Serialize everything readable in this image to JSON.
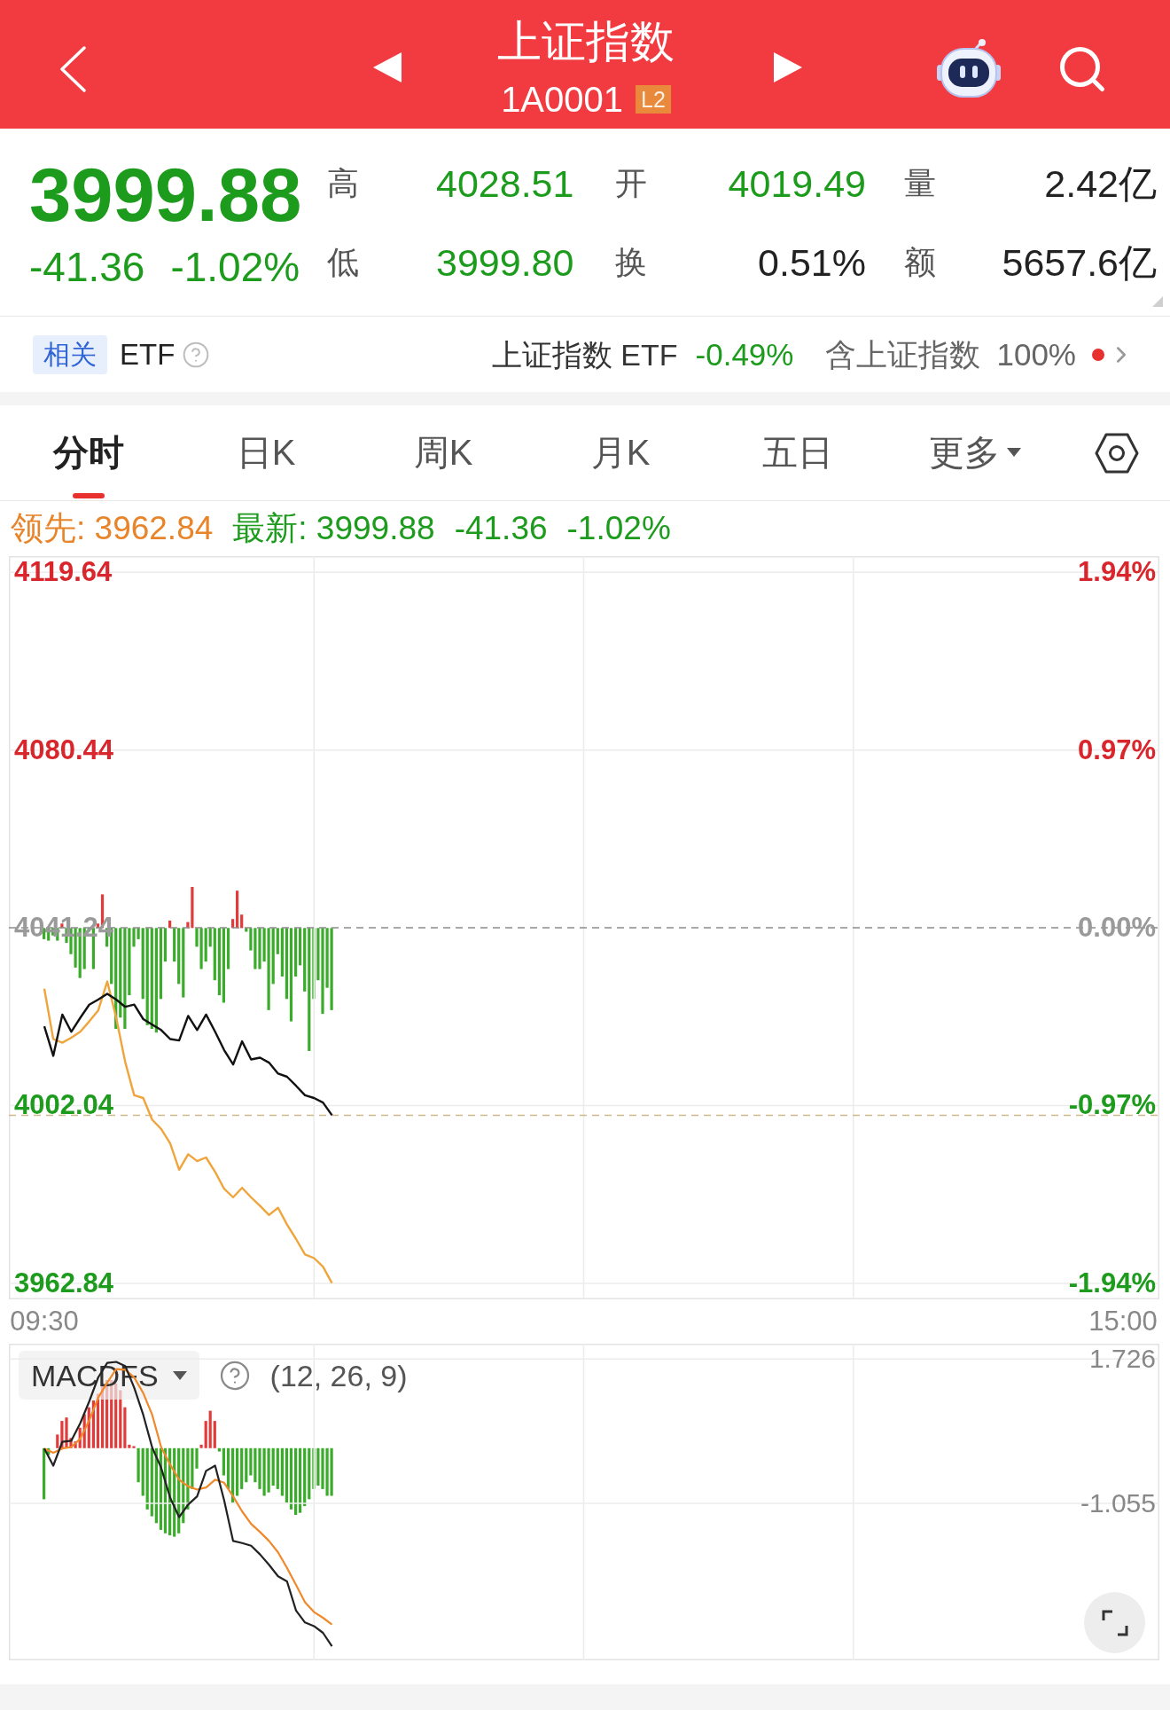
{
  "header": {
    "title": "上证指数",
    "code": "1A0001",
    "badge": "L2"
  },
  "quote": {
    "price": "3999.88",
    "change": "-41.36",
    "change_pct": "-1.02%",
    "falling": true,
    "stats": [
      {
        "label": "高",
        "value": "4028.51",
        "color": "#1c9b1c"
      },
      {
        "label": "开",
        "value": "4019.49",
        "color": "#1c9b1c"
      },
      {
        "label": "量",
        "value": "2.42亿",
        "color": "#222222"
      },
      {
        "label": "低",
        "value": "3999.80",
        "color": "#1c9b1c"
      },
      {
        "label": "换",
        "value": "0.51%",
        "color": "#222222"
      },
      {
        "label": "额",
        "value": "5657.6亿",
        "color": "#222222"
      }
    ]
  },
  "etf_row": {
    "tag": "相关",
    "label": "ETF",
    "fund": "上证指数 ETF",
    "fund_change": "-0.49%",
    "fund_falling": true,
    "holding_label": "含上证指数",
    "holding_pct": "100%"
  },
  "tabs": [
    {
      "label": "分时",
      "kind": "tab",
      "selected": true
    },
    {
      "label": "日K",
      "kind": "tab",
      "selected": false
    },
    {
      "label": "周K",
      "kind": "tab",
      "selected": false
    },
    {
      "label": "月K",
      "kind": "tab",
      "selected": false
    },
    {
      "label": "五日",
      "kind": "tab",
      "selected": false
    },
    {
      "label": "更多",
      "kind": "menu",
      "selected": false
    }
  ],
  "intraday": {
    "legend": [
      {
        "text": "领先: 3962.84",
        "kind": "lead"
      },
      {
        "text": "最新: 3999.88",
        "kind": "latest"
      },
      {
        "text": "-41.36",
        "kind": "latest"
      },
      {
        "text": "-1.02%",
        "kind": "latest"
      }
    ],
    "percent_ticks": [
      "1.94%",
      "0.97%",
      "0.00%",
      "-0.97%",
      "-1.94%"
    ],
    "chart_data": {
      "type": "line",
      "grid": true,
      "categories": [
        "09:30",
        null,
        null,
        null,
        null,
        null,
        null,
        null,
        null,
        null,
        null,
        null,
        null,
        null,
        null,
        null,
        null,
        null,
        null,
        null,
        null,
        null,
        null,
        null,
        null,
        null,
        null,
        null,
        null,
        null,
        null,
        null,
        null,
        null,
        null,
        null,
        null,
        null,
        null,
        null,
        null,
        null,
        null,
        null,
        null,
        null,
        null,
        null,
        null,
        null,
        null,
        null,
        null,
        null,
        null,
        null,
        null,
        null,
        null,
        null,
        null,
        null,
        null,
        null,
        null,
        null,
        null,
        null,
        null,
        null,
        null,
        null,
        null,
        null,
        null,
        null,
        null,
        null,
        null,
        null,
        null,
        null,
        null,
        null,
        null,
        null,
        null,
        null,
        null,
        null,
        null,
        null,
        null,
        null,
        null,
        null,
        null,
        null,
        null,
        null,
        null,
        null,
        null,
        null,
        null,
        null,
        null,
        null,
        null,
        null,
        null,
        null,
        null,
        null,
        null,
        null,
        null,
        null,
        null,
        null,
        "15:00"
      ],
      "ylim": [
        3959.3,
        4123.2
      ],
      "yticks": [
        {
          "value": 4119.64,
          "label": "4119.64"
        },
        {
          "value": 4080.44,
          "label": "4080.44"
        },
        {
          "value": 4041.24,
          "label": "4041.24"
        },
        {
          "value": 4002.04,
          "label": "4002.04"
        },
        {
          "value": 3962.84,
          "label": "3962.84"
        }
      ],
      "series": [
        {
          "color": "#111111",
          "values": [
            4019.5,
            4013.0,
            4022.1,
            4018.3,
            4021.4,
            4024.3,
            4025.4,
            4026.7,
            4025.4,
            4023.8,
            4024.3,
            4021.1,
            4019.9,
            4018.7,
            4016.7,
            4016.4,
            4021.8,
            4018.7,
            4022.1,
            4018.3,
            4014.3,
            4011.1,
            4016.2,
            4012.2,
            4012.6,
            4011.5,
            4009.1,
            4008.4,
            4006.4,
            4004.3,
            4003.7,
            4002.7,
            3999.9,
            null,
            null,
            null,
            null,
            null,
            null,
            null,
            null,
            null,
            null,
            null,
            null,
            null,
            null,
            null,
            null,
            null,
            null,
            null,
            null,
            null,
            null,
            null,
            null,
            null,
            null,
            null,
            null,
            null,
            null,
            null,
            null,
            null,
            null,
            null,
            null,
            null,
            null,
            null,
            null,
            null,
            null,
            null,
            null,
            null,
            null,
            null,
            null,
            null,
            null,
            null,
            null,
            null,
            null,
            null,
            null,
            null,
            null,
            null,
            null,
            null,
            null,
            null,
            null,
            null,
            null,
            null,
            null,
            null,
            null,
            null,
            null,
            null,
            null,
            null,
            null,
            null,
            null,
            null,
            null,
            null,
            null,
            null,
            null,
            null,
            null,
            null,
            null
          ]
        },
        {
          "color": "#f0a53c",
          "values": [
            4027.8,
            4016.7,
            4015.9,
            4017.0,
            4018.3,
            4020.6,
            4023.0,
            4029.4,
            4021.4,
            4011.6,
            4004.3,
            4003.7,
            3998.9,
            3996.9,
            3993.7,
            3987.9,
            3991.3,
            3989.8,
            3990.6,
            3987.4,
            3983.7,
            3981.8,
            3983.9,
            3981.8,
            3979.9,
            3977.9,
            3979.5,
            3975.8,
            3972.6,
            3969.2,
            3968.4,
            3966.5,
            3962.9,
            null,
            null,
            null,
            null,
            null,
            null,
            null,
            null,
            null,
            null,
            null,
            null,
            null,
            null,
            null,
            null,
            null,
            null,
            null,
            null,
            null,
            null,
            null,
            null,
            null,
            null,
            null,
            null,
            null,
            null,
            null,
            null,
            null,
            null,
            null,
            null,
            null,
            null,
            null,
            null,
            null,
            null,
            null,
            null,
            null,
            null,
            null,
            null,
            null,
            null,
            null,
            null,
            null,
            null,
            null,
            null,
            null,
            null,
            null,
            null,
            null,
            null,
            null,
            null,
            null,
            null,
            null,
            null,
            null,
            null,
            null,
            null,
            null,
            null,
            null,
            null,
            null,
            null,
            null,
            null,
            null,
            null,
            null,
            null,
            null,
            null,
            null,
            null
          ]
        }
      ],
      "ref_lines": [
        {
          "axis": "y",
          "value": 4041.24,
          "color": "#8c8c8c"
        },
        {
          "axis": "y",
          "value": 3999.88,
          "color": "#cdb78d"
        }
      ]
    }
  },
  "macd": {
    "indicator": "MACDFS",
    "params": "(12, 26, 9)",
    "chart_data": {
      "type": "line",
      "grid": true,
      "categories": [
        null,
        null,
        null,
        null,
        null,
        null,
        null,
        null,
        null,
        null,
        null,
        null,
        null,
        null,
        null,
        null,
        null,
        null,
        null,
        null,
        null,
        null,
        null,
        null,
        null,
        null,
        null,
        null,
        null,
        null,
        null,
        null,
        null,
        null,
        null,
        null,
        null,
        null,
        null,
        null,
        null,
        null,
        null,
        null,
        null,
        null,
        null,
        null,
        null,
        null,
        null,
        null,
        null,
        null,
        null,
        null,
        null,
        null,
        null,
        null,
        null,
        null,
        null,
        null,
        null,
        null,
        null,
        null,
        null,
        null,
        null,
        null,
        null,
        null,
        null,
        null,
        null,
        null,
        null,
        null,
        null,
        null,
        null,
        null,
        null,
        null,
        null,
        null,
        null,
        null,
        null,
        null,
        null,
        null,
        null,
        null,
        null,
        null,
        null,
        null,
        null,
        null,
        null,
        null,
        null,
        null,
        null,
        null,
        null,
        null,
        null,
        null,
        null,
        null,
        null,
        null,
        null,
        null,
        null,
        null,
        null
      ],
      "ylim": [
        -4.08,
        2.02
      ],
      "yticks": [
        {
          "value": 1.726,
          "label": "1.726"
        },
        {
          "value": -1.055,
          "label": "-1.055"
        }
      ],
      "series": [
        {
          "color": "#222222",
          "values": [
            0.0,
            -0.33,
            0.13,
            0.15,
            0.49,
            0.91,
            1.37,
            1.65,
            1.67,
            1.59,
            1.17,
            0.65,
            0.02,
            -0.37,
            -0.95,
            -1.32,
            -1.08,
            -0.92,
            -0.43,
            -0.33,
            -0.99,
            -1.78,
            -1.82,
            -1.87,
            -2.04,
            -2.24,
            -2.46,
            -2.56,
            -3.12,
            -3.35,
            -3.42,
            -3.55,
            -3.81,
            null,
            null,
            null,
            null,
            null,
            null,
            null,
            null,
            null,
            null,
            null,
            null,
            null,
            null,
            null,
            null,
            null,
            null,
            null,
            null,
            null,
            null,
            null,
            null,
            null,
            null,
            null,
            null,
            null,
            null,
            null,
            null,
            null,
            null,
            null,
            null,
            null,
            null,
            null,
            null,
            null,
            null,
            null,
            null,
            null,
            null,
            null,
            null,
            null,
            null,
            null,
            null,
            null,
            null,
            null,
            null,
            null,
            null,
            null,
            null,
            null,
            null,
            null,
            null,
            null,
            null,
            null,
            null,
            null,
            null,
            null,
            null,
            null,
            null,
            null,
            null,
            null,
            null,
            null,
            null,
            null,
            null,
            null,
            null,
            null,
            null,
            null,
            null
          ]
        },
        {
          "color": "#f0892a",
          "values": [
            0.0,
            -0.08,
            0.0,
            0.03,
            0.19,
            0.54,
            0.98,
            1.27,
            1.53,
            1.52,
            1.37,
            1.07,
            0.65,
            0.03,
            -0.31,
            -0.6,
            -0.73,
            -0.79,
            -0.75,
            -0.6,
            -0.66,
            -0.92,
            -1.21,
            -1.45,
            -1.61,
            -1.78,
            -2.0,
            -2.3,
            -2.63,
            -2.96,
            -3.15,
            -3.26,
            -3.39,
            null,
            null,
            null,
            null,
            null,
            null,
            null,
            null,
            null,
            null,
            null,
            null,
            null,
            null,
            null,
            null,
            null,
            null,
            null,
            null,
            null,
            null,
            null,
            null,
            null,
            null,
            null,
            null,
            null,
            null,
            null,
            null,
            null,
            null,
            null,
            null,
            null,
            null,
            null,
            null,
            null,
            null,
            null,
            null,
            null,
            null,
            null,
            null,
            null,
            null,
            null,
            null,
            null,
            null,
            null,
            null,
            null,
            null,
            null,
            null,
            null,
            null,
            null,
            null,
            null,
            null,
            null,
            null,
            null,
            null,
            null,
            null,
            null,
            null,
            null,
            null,
            null,
            null,
            null,
            null,
            null,
            null,
            null,
            null,
            null,
            null,
            null,
            null
          ]
        }
      ]
    }
  }
}
